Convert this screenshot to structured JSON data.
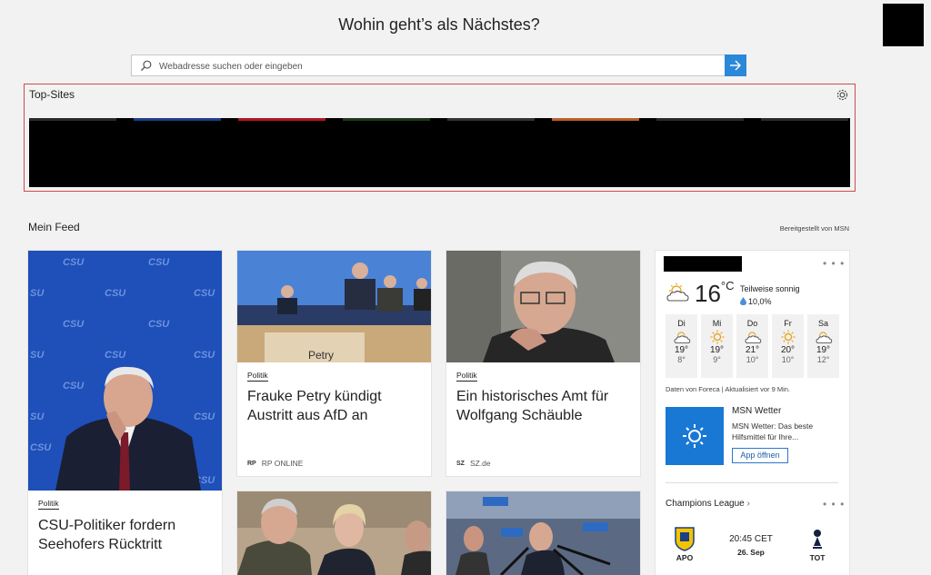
{
  "header": {
    "headline": "Wohin geht’s als Nächstes?"
  },
  "search": {
    "placeholder": "Webadresse suchen oder eingeben"
  },
  "topsites": {
    "title": "Top-Sites",
    "accents": [
      "#2a2a2a",
      "#1c3f86",
      "#b3161f",
      "#1b3a1b",
      "#333333",
      "#b8602a",
      "#2a2a2a",
      "#2a2a2a"
    ]
  },
  "feed": {
    "title": "Mein Feed",
    "provider": "Bereitgestellt von MSN"
  },
  "cards": [
    {
      "category": "Politik",
      "title": "CSU-Politiker fordern Seehofers Rücktritt"
    },
    {
      "category": "Politik",
      "title": "Frauke Petry kündigt Austritt aus AfD an",
      "source": "RP ONLINE",
      "source_logo": "RP"
    },
    {
      "category": "Politik",
      "title": "Ein historisches Amt für Wolfgang Schäuble",
      "source": "SZ.de",
      "source_logo": "SZ"
    }
  ],
  "weather": {
    "temp": "16",
    "unit": "°C",
    "desc": "Teilweise sonnig",
    "rain": "10,0%",
    "days": [
      {
        "name": "Di",
        "high": "19°",
        "low": "8°",
        "icon": "partly-cloudy"
      },
      {
        "name": "Mi",
        "high": "19°",
        "low": "9°",
        "icon": "sunny"
      },
      {
        "name": "Do",
        "high": "21°",
        "low": "10°",
        "icon": "partly-cloudy"
      },
      {
        "name": "Fr",
        "high": "20°",
        "low": "10°",
        "icon": "sunny"
      },
      {
        "name": "Sa",
        "high": "19°",
        "low": "12°",
        "icon": "partly-cloudy"
      }
    ],
    "source": "Daten von Foreca | Aktualisiert vor 9 Min.",
    "app_name": "MSN Wetter",
    "app_desc": "MSN Wetter: Das beste Hilfsmittel für Ihre...",
    "app_button": "App öffnen"
  },
  "sports": {
    "title": "Champions League",
    "home": "APO",
    "away": "TOT",
    "time": "20:45 CET",
    "date": "26. Sep"
  },
  "colors": {
    "accent": "#2b88d8",
    "weather_tile": "#1978d4"
  }
}
